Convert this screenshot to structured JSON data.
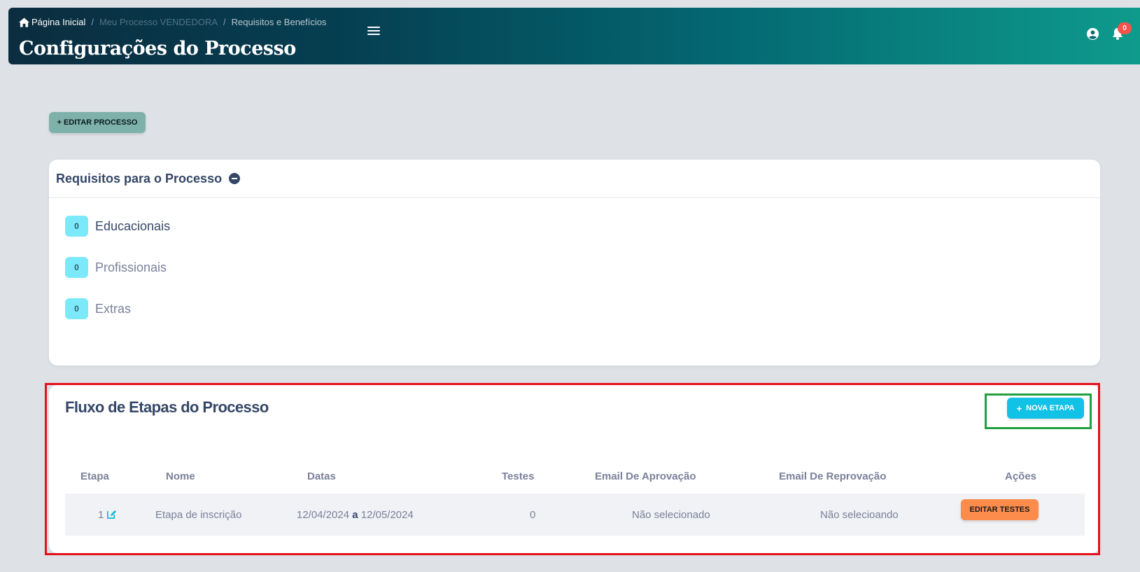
{
  "header": {
    "breadcrumb": {
      "home": "Página Inicial",
      "process": "Meu Processo VENDEDORA",
      "current": "Requisitos e Benefícios",
      "separator": "/"
    },
    "title": "Configurações do Processo",
    "notifications_count": "0"
  },
  "actions": {
    "edit_process_plus": "+",
    "edit_process_label": "EDITAR PROCESSO"
  },
  "requirements": {
    "title": "Requisitos para o Processo",
    "items": [
      {
        "count": "0",
        "label": "Educacionais"
      },
      {
        "count": "0",
        "label": "Profissionais"
      },
      {
        "count": "0",
        "label": "Extras"
      }
    ]
  },
  "flow": {
    "title": "Fluxo de Etapas do Processo",
    "new_stage_plus": "+",
    "new_stage_label": "NOVA ETAPA",
    "columns": [
      "Etapa",
      "Nome",
      "Datas",
      "Testes",
      "Email De Aprovação",
      "Email De Reprovação",
      "Ações"
    ],
    "rows": [
      {
        "stage": "1",
        "name": "Etapa de inscrição",
        "date_start": "12/04/2024",
        "date_sep": "a",
        "date_end": "12/05/2024",
        "tests": "0",
        "approval_email": "Não selecionado",
        "rejection_email": "Não selecioando",
        "action_label": "EDITAR TESTES"
      }
    ]
  },
  "colors": {
    "header_gradient_start": "#0b2d3f",
    "header_gradient_end": "#0e9b8c",
    "edit_process_button": "#7fb1ab",
    "count_badge": "#7ce9fa",
    "new_stage_button": "#12c1e6",
    "edit_tests_button": "#fb8c4c",
    "notification_badge": "#f5544a",
    "highlight_red": "#e3111b",
    "highlight_green": "#20a040"
  }
}
